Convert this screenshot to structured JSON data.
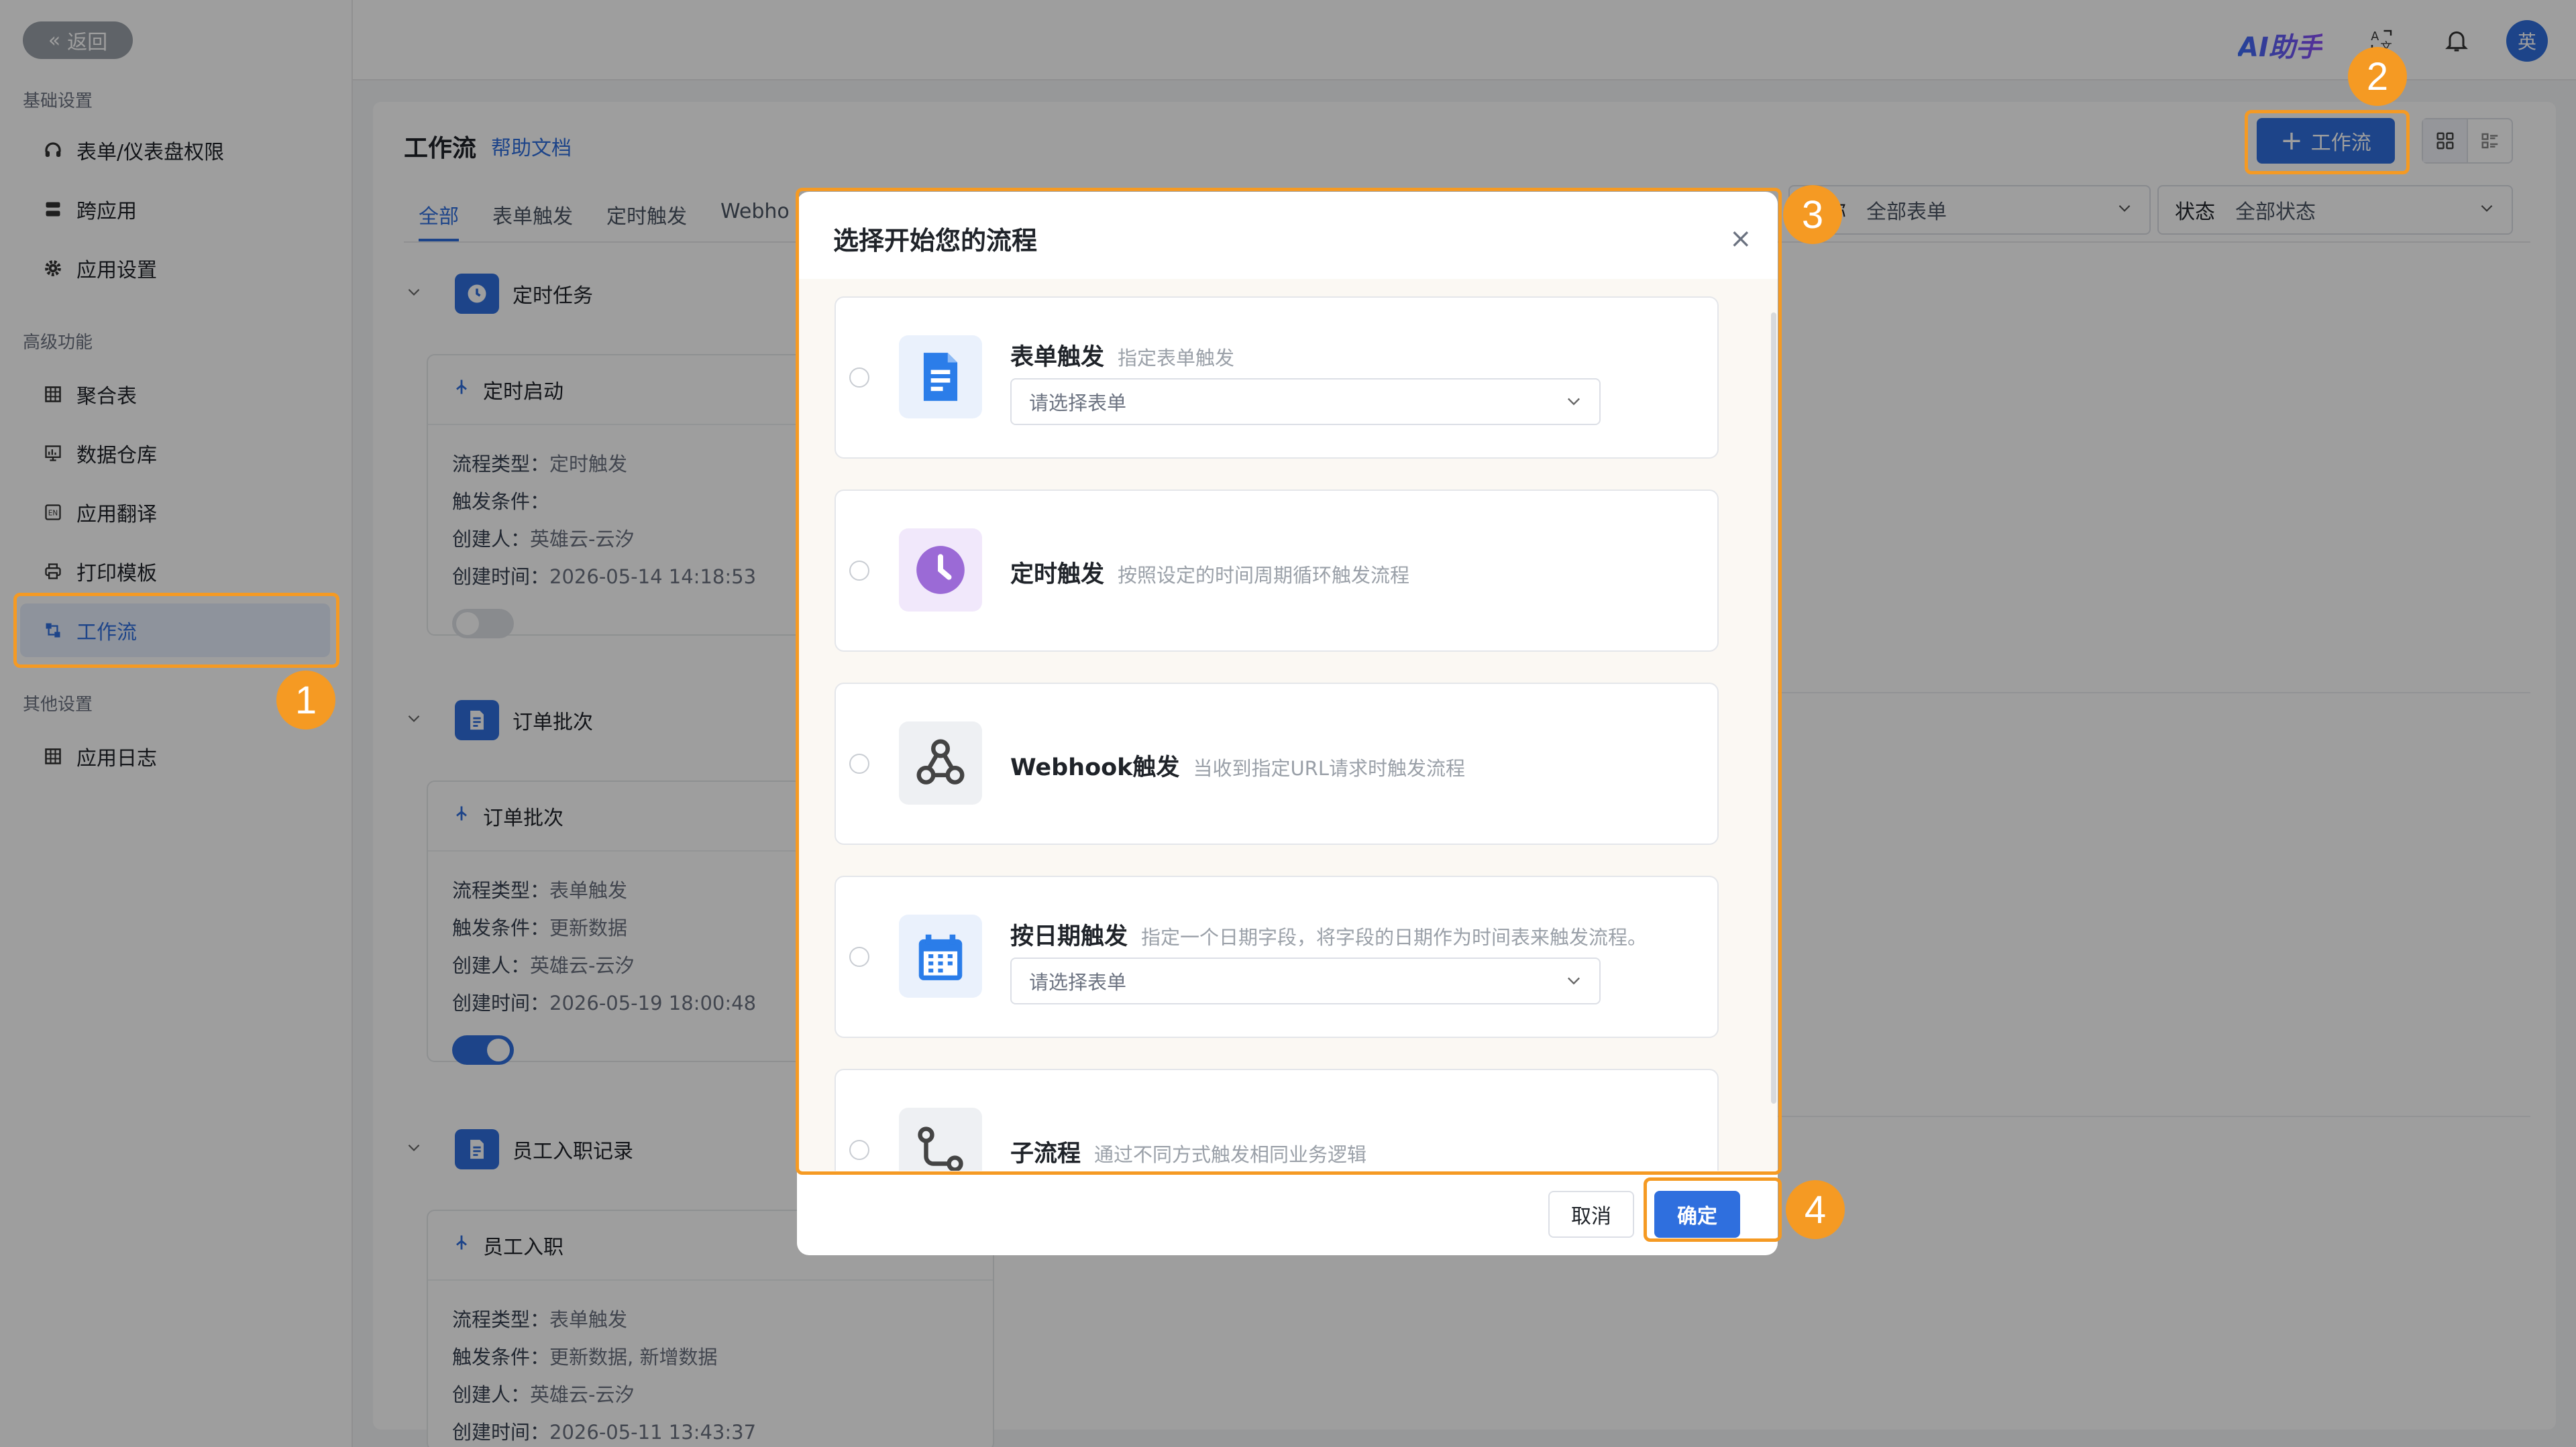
{
  "sidebar": {
    "back_label": "返回",
    "sections": [
      {
        "title": "基础设置"
      },
      {
        "title": "高级功能"
      },
      {
        "title": "其他设置"
      }
    ],
    "items": [
      {
        "label": "表单/仪表盘权限",
        "icon": "headset-icon"
      },
      {
        "label": "跨应用",
        "icon": "stack-icon"
      },
      {
        "label": "应用设置",
        "icon": "gear-icon"
      },
      {
        "label": "聚合表",
        "icon": "table-icon"
      },
      {
        "label": "数据仓库",
        "icon": "chart-icon"
      },
      {
        "label": "应用翻译",
        "icon": "translate-icon"
      },
      {
        "label": "打印模板",
        "icon": "printer-icon"
      },
      {
        "label": "工作流",
        "icon": "workflow-icon",
        "active": true
      },
      {
        "label": "应用日志",
        "icon": "grid-icon"
      }
    ]
  },
  "topbar": {
    "ai_label": "AI助手",
    "avatar_text": "英"
  },
  "header": {
    "title": "工作流",
    "help_link": "帮助文档",
    "add_button": "工作流"
  },
  "tabs": [
    "全部",
    "表单触发",
    "定时触发",
    "Webho"
  ],
  "filters": [
    {
      "label": "名称",
      "value": "全部表单"
    },
    {
      "label": "状态",
      "value": "全部状态"
    }
  ],
  "groups": [
    {
      "name": "定时任务",
      "card": {
        "title": "定时启动",
        "rows": [
          {
            "k": "流程类型：",
            "v": "定时触发"
          },
          {
            "k": "触发条件：",
            "v": ""
          },
          {
            "k": "创建人：",
            "v": "英雄云-云汐"
          },
          {
            "k": "创建时间：",
            "v": "2026-05-14 14:18:53"
          }
        ],
        "enabled": false
      }
    },
    {
      "name": "订单批次",
      "card": {
        "title": "订单批次",
        "rows": [
          {
            "k": "流程类型：",
            "v": "表单触发"
          },
          {
            "k": "触发条件：",
            "v": "更新数据"
          },
          {
            "k": "创建人：",
            "v": "英雄云-云汐"
          },
          {
            "k": "创建时间：",
            "v": "2026-05-19 18:00:48"
          }
        ],
        "enabled": true
      }
    },
    {
      "name": "员工入职记录",
      "card": {
        "title": "员工入职",
        "rows": [
          {
            "k": "流程类型：",
            "v": "表单触发"
          },
          {
            "k": "触发条件：",
            "v": "更新数据, 新增数据"
          },
          {
            "k": "创建人：",
            "v": "英雄云-云汐"
          },
          {
            "k": "创建时间：",
            "v": "2026-05-11 13:43:37"
          }
        ]
      }
    }
  ],
  "dialog": {
    "title": "选择开始您的流程",
    "options": [
      {
        "name": "表单触发",
        "desc": "指定表单触发",
        "select_placeholder": "请选择表单",
        "icon": "document-icon"
      },
      {
        "name": "定时触发",
        "desc": "按照设定的时间周期循环触发流程",
        "icon": "clock-icon"
      },
      {
        "name": "Webhook触发",
        "desc": "当收到指定URL请求时触发流程",
        "icon": "webhook-icon"
      },
      {
        "name": "按日期触发",
        "desc": "指定一个日期字段，将字段的日期作为时间表来触发流程。",
        "select_placeholder": "请选择表单",
        "icon": "calendar-icon"
      },
      {
        "name": "子流程",
        "desc": "通过不同方式触发相同业务逻辑",
        "icon": "subflow-icon"
      }
    ],
    "cancel_label": "取消",
    "ok_label": "确定"
  },
  "callouts": [
    "1",
    "2",
    "3",
    "4"
  ],
  "colors": {
    "primary": "#2f6fde",
    "callout": "#f59a23",
    "timer_icon_bg": "#f1e8fb",
    "timer_icon": "#9b6ad6"
  }
}
